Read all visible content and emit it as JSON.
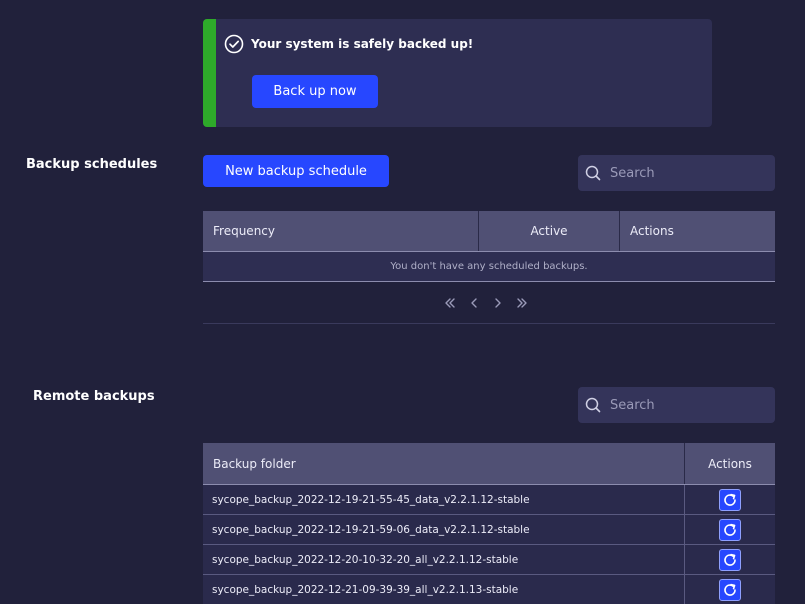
{
  "banner": {
    "message": "Your system is safely backed up!",
    "backup_button": "Back up now",
    "accent_color": "#2eaa2a"
  },
  "schedules": {
    "title": "Backup schedules",
    "new_button": "New backup schedule",
    "search_placeholder": "Search",
    "columns": [
      "Frequency",
      "Active",
      "Actions"
    ],
    "empty_message": "You don't have any scheduled backups.",
    "pager_icons": [
      "first-page-icon",
      "prev-page-icon",
      "next-page-icon",
      "last-page-icon"
    ]
  },
  "remote": {
    "title": "Remote backups",
    "search_placeholder": "Search",
    "columns": [
      "Backup folder",
      "Actions"
    ],
    "rows": [
      "sycope_backup_2022-12-19-21-55-45_data_v2.2.1.12-stable",
      "sycope_backup_2022-12-19-21-59-06_data_v2.2.1.12-stable",
      "sycope_backup_2022-12-20-10-32-20_all_v2.2.1.12-stable",
      "sycope_backup_2022-12-21-09-39-39_all_v2.2.1.13-stable"
    ],
    "row_action_icon": "refresh-icon"
  }
}
